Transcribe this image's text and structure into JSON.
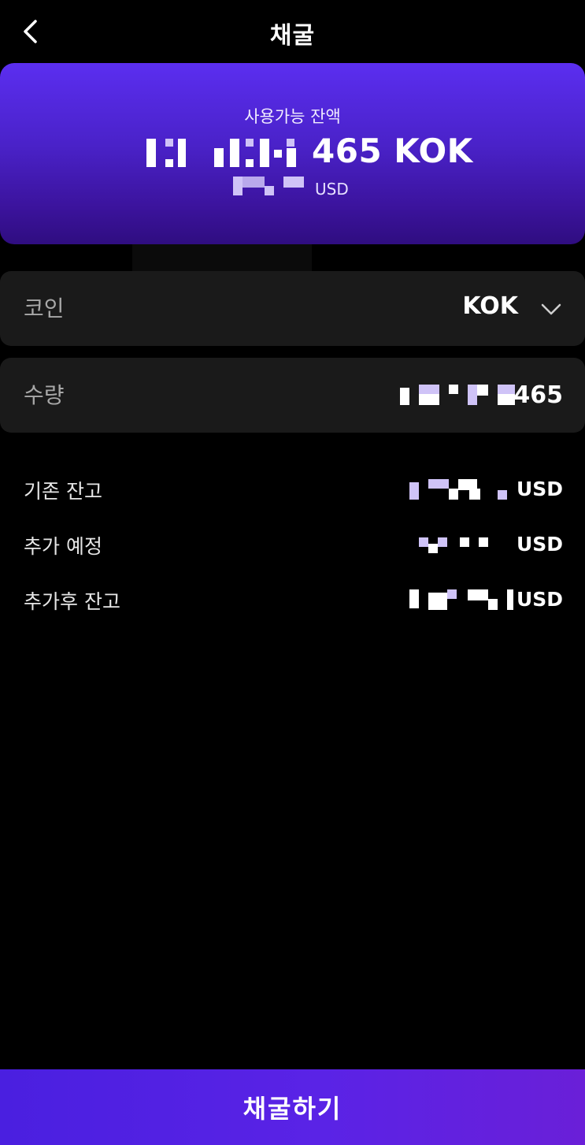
{
  "header": {
    "title": "채굴",
    "back_icon": "chevron-left-icon"
  },
  "balance": {
    "label": "사용가능 잔액",
    "amount_suffix": "465 KOK",
    "usd_unit": "USD"
  },
  "coin_field": {
    "label": "코인",
    "value": "KOK",
    "icon": "chevron-down-icon"
  },
  "quantity_field": {
    "label": "수량",
    "value_suffix": "465"
  },
  "summary": {
    "rows": [
      {
        "label": "기존 잔고",
        "unit": "USD"
      },
      {
        "label": "추가 예정",
        "unit": "USD"
      },
      {
        "label": "추가후 잔고",
        "unit": "USD"
      }
    ]
  },
  "cta": {
    "label": "채굴하기"
  },
  "colors": {
    "accent": "#5b2ef0",
    "background": "#000000",
    "field_bg": "#1a1a1a"
  }
}
